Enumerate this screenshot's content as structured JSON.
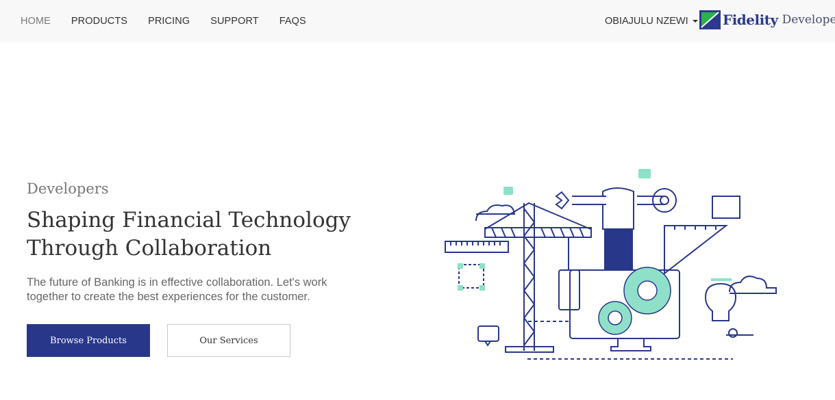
{
  "nav": {
    "items": [
      {
        "label": "HOME",
        "active": true
      },
      {
        "label": "PRODUCTS",
        "active": false
      },
      {
        "label": "PRICING",
        "active": false
      },
      {
        "label": "SUPPORT",
        "active": false
      },
      {
        "label": "FAQS",
        "active": false
      }
    ],
    "user_name": "OBIAJULU NZEWI",
    "brand": {
      "name": "Fidelity",
      "sub": "Developer"
    }
  },
  "hero": {
    "eyebrow": "Developers",
    "title_line1": "Shaping Financial Technology",
    "title_line2": "Through Collaboration",
    "text": "The future of Banking is in effective collaboration. Let's work together to create the best experiences for the customer.",
    "primary_button": "Browse Products",
    "secondary_button": "Our Services"
  },
  "colors": {
    "navy": "#29378a",
    "mint": "#8fe0c9",
    "navbar_bg": "#f8f8f8"
  }
}
